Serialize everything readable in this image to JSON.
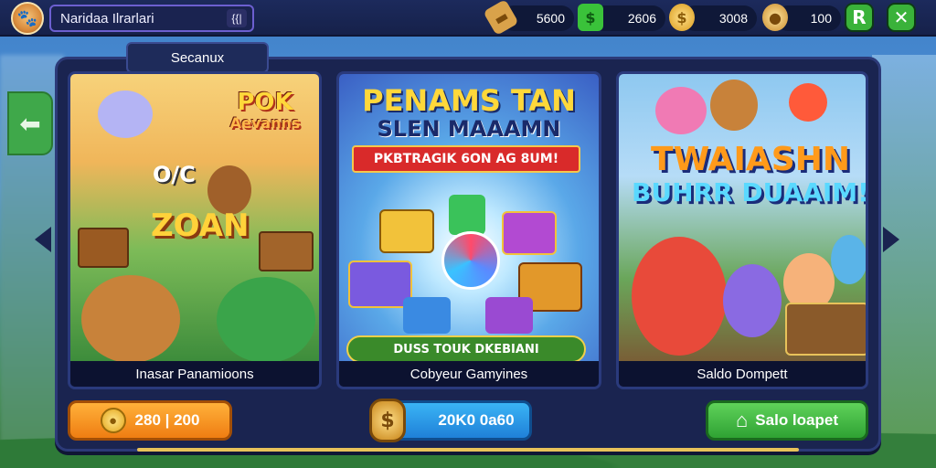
{
  "header": {
    "player_name": "Nаridaa Ilrarlari",
    "player_badge": "{{|",
    "resources": [
      {
        "icon": "ticket-icon",
        "value": "5600"
      },
      {
        "icon": "cash-icon",
        "value": "2606"
      },
      {
        "icon": "coin-icon",
        "value": "3008"
      },
      {
        "icon": "gold-pouch-icon",
        "value": "100"
      }
    ]
  },
  "panel": {
    "tab_label": "Secanux"
  },
  "cards": [
    {
      "title_line1": "POK",
      "title_line2": "Aevanns",
      "art_text_1": "O/C",
      "art_text_2": "ZOAN",
      "caption": "Inasar Panamioons",
      "button_label": "280 | 200"
    },
    {
      "title_line1": "PENAMS TAN",
      "title_line2": "SLEN MAAAMN",
      "banner": "PKBTRAGIK 6ON AG 8UM!",
      "pill": "DUSS TOUK DKEBIANI",
      "caption": "Cobyeur Gamyines",
      "button_label": "20K0 0a60"
    },
    {
      "title_line1": "TWAIASHN",
      "title_line2": "BUHRR DUAAIM!",
      "caption": "Saldo Dompett",
      "button_label": "Salo loapet"
    }
  ],
  "colors": {
    "topbar": "#1c2a5c",
    "panel": "#1a2450",
    "orange_button": "#ef7d12",
    "blue_button": "#1f80d8",
    "green_button": "#2fa233"
  }
}
